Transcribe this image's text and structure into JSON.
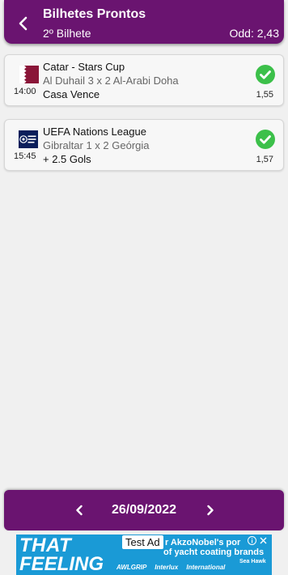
{
  "header": {
    "title": "Bilhetes Prontos",
    "subtitle": "2º Bilhete",
    "odd_label": "Odd: 2,43",
    "back_icon": "chevron-left-icon"
  },
  "tickets": [
    {
      "league": "Catar - Stars Cup",
      "match": "Al Duhail 3 x 2 Al-Arabi Doha",
      "market": "Casa Vence",
      "time": "14:00",
      "odd": "1,55",
      "logo": "qatar-flag-icon",
      "status_icon": "check-circle-icon",
      "status_color": "#3cc04a"
    },
    {
      "league": "UEFA Nations League",
      "match": "Gibraltar 1 x 2 Geórgia",
      "market": "+ 2.5 Gols",
      "time": "15:45",
      "odd": "1,57",
      "logo": "uefa-nations-league-logo",
      "status_icon": "check-circle-icon",
      "status_color": "#3cc04a"
    }
  ],
  "footer": {
    "date": "26/09/2022",
    "prev_icon": "chevron-left-icon",
    "next_icon": "chevron-right-icon"
  },
  "ad": {
    "headline_line1": "THAT",
    "headline_line2": "FEELING",
    "badge": "Test Ad",
    "copy_line1": "r AkzoNobel's por",
    "copy_line2": "of yacht coating brands",
    "brands": "AWLGRIP Interlux International",
    "seahawk": "Sea Hawk"
  },
  "colors": {
    "brand_purple": "#6a1470",
    "success_green": "#3cc04a",
    "ad_blue": "#1a9ad6"
  }
}
